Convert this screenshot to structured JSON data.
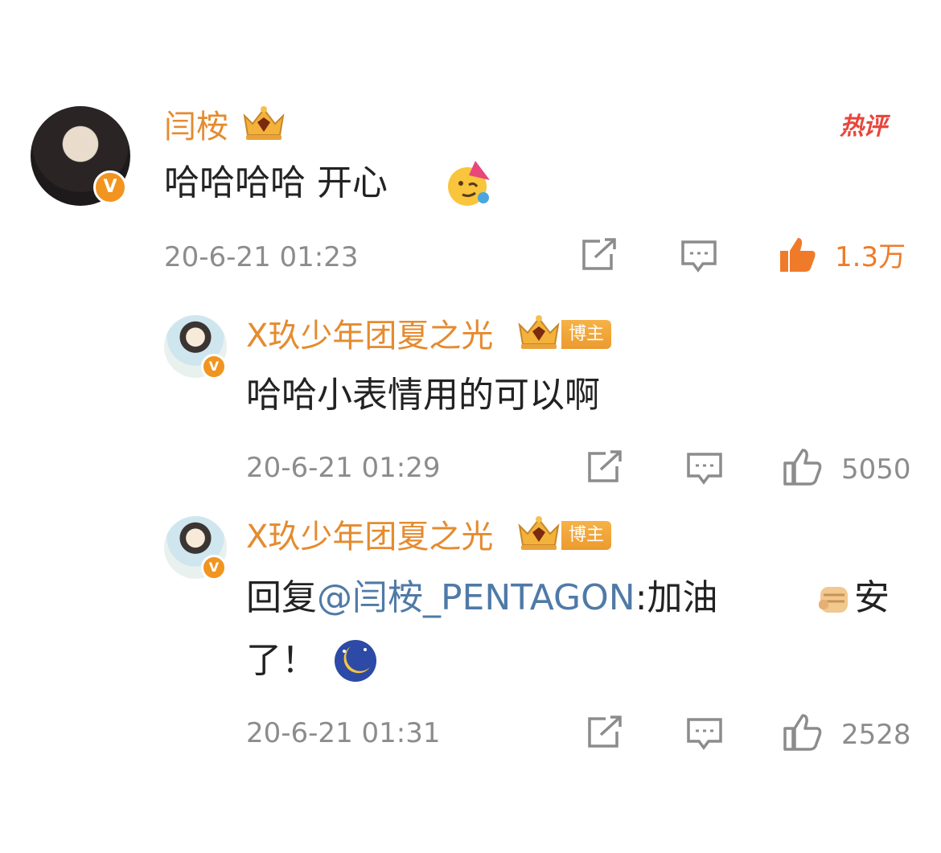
{
  "comments": [
    {
      "username": "闫桉",
      "hot_tag": "热评",
      "text": "哈哈哈哈 开心",
      "emoji": "partying-face-emoji",
      "timestamp": "20-6-21 01:23",
      "like_count": "1.3万",
      "liked": true
    },
    {
      "username": "X玖少年团夏之光",
      "badge": "博主",
      "text": "哈哈小表情用的可以啊",
      "timestamp": "20-6-21 01:29",
      "like_count": "5050",
      "liked": false
    },
    {
      "username": "X玖少年团夏之光",
      "badge": "博主",
      "reply_prefix": "回复",
      "mention": "@闫桉_PENTAGON",
      "text_part1": ":加油",
      "text_part2": "安",
      "text_line2": "了！",
      "emojis": [
        "fist-emoji",
        "moon-face-emoji"
      ],
      "timestamp": "20-6-21 01:31",
      "like_count": "2528",
      "liked": false
    }
  ],
  "verified_badge": "V",
  "icons": [
    "share-icon",
    "comment-icon",
    "like-icon",
    "crown-badge-icon"
  ],
  "colors": {
    "username": "#e58b2f",
    "mention": "#4f7aa7",
    "liked": "#ef7b2a",
    "hot_tag": "#e9463c",
    "meta": "#8c8c8c"
  }
}
